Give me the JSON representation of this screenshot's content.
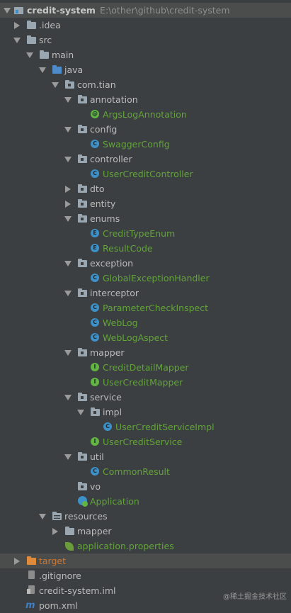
{
  "project": {
    "name": "credit-system",
    "path": "E:\\other\\github\\credit-system"
  },
  "tree": {
    "idea": ".idea",
    "src": "src",
    "main": "main",
    "java": "java",
    "pkg": "com.tian",
    "annotation": "annotation",
    "args_log_annotation": "ArgsLogAnnotation",
    "config": "config",
    "swagger_config": "SwaggerConfig",
    "controller": "controller",
    "user_credit_controller": "UserCreditController",
    "dto": "dto",
    "entity": "entity",
    "enums": "enums",
    "credit_type_enum": "CreditTypeEnum",
    "result_code": "ResultCode",
    "exception": "exception",
    "global_exception_handler": "GlobalExceptionHandler",
    "interceptor": "interceptor",
    "parameter_check_inspect": "ParameterCheckInspect",
    "web_log": "WebLog",
    "web_log_aspect": "WebLogAspect",
    "mapper": "mapper",
    "credit_detail_mapper": "CreditDetailMapper",
    "user_credit_mapper": "UserCreditMapper",
    "service": "service",
    "impl": "impl",
    "user_credit_service_impl": "UserCreditServiceImpl",
    "user_credit_service": "UserCreditService",
    "util": "util",
    "common_result": "CommonResult",
    "vo": "vo",
    "application": "Application",
    "resources": "resources",
    "res_mapper": "mapper",
    "application_properties": "application.properties",
    "target": "target",
    "gitignore": ".gitignore",
    "iml": "credit-system.iml",
    "pom": "pom.xml"
  },
  "badges": {
    "class": "C",
    "annotation": "@",
    "enum": "E",
    "interface": "I",
    "maven": "m"
  },
  "watermark": "@稀土掘金技术社区",
  "colors": {
    "background": "#3c3f41",
    "text": "#bbbbbb",
    "class_text": "#62a33a",
    "target_text": "#cc7832",
    "source_folder": "#4e8bca"
  }
}
